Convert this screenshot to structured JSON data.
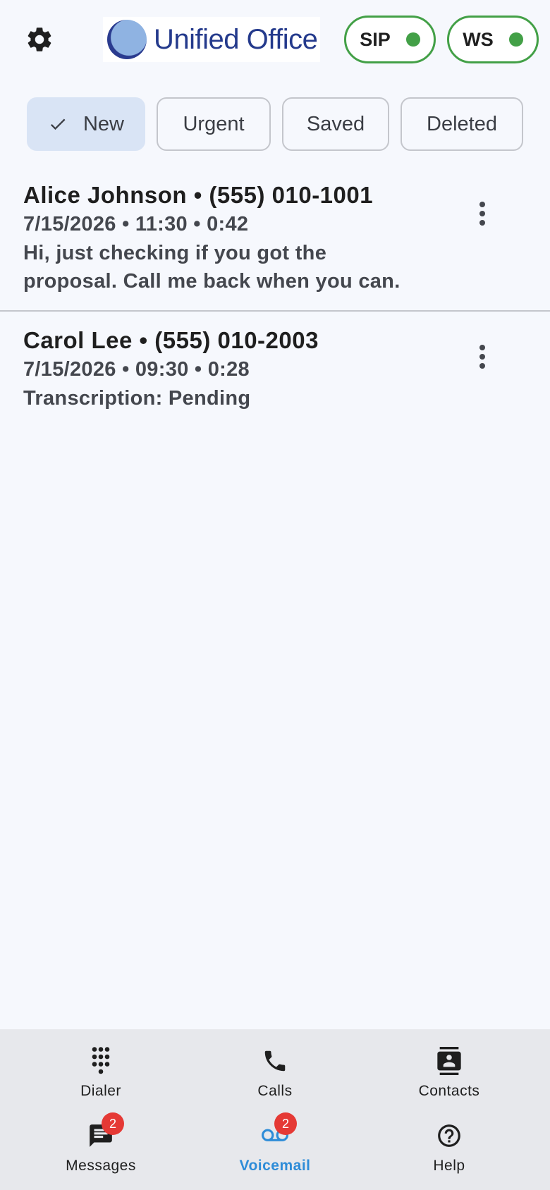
{
  "header": {
    "logo_text": "Unified Office",
    "status": [
      {
        "label": "SIP",
        "color": "#43a047"
      },
      {
        "label": "WS",
        "color": "#43a047"
      }
    ]
  },
  "filters": {
    "selected": "New",
    "chips": [
      "New",
      "Urgent",
      "Saved",
      "Deleted"
    ]
  },
  "voicemails": [
    {
      "title": "Alice Johnson • (555) 010-1001",
      "meta": "7/15/2026 • 11:30 • 0:42",
      "text": "Hi, just checking if you got the proposal. Call me back when you can."
    },
    {
      "title": "Carol Lee • (555) 010-2003",
      "meta": "7/15/2026 • 09:30 • 0:28",
      "text": "Transcription: Pending"
    }
  ],
  "nav": {
    "items": [
      {
        "label": "Dialer",
        "icon": "dialpad-icon"
      },
      {
        "label": "Calls",
        "icon": "phone-icon"
      },
      {
        "label": "Contacts",
        "icon": "contacts-icon"
      },
      {
        "label": "Messages",
        "icon": "message-icon",
        "badge": "2"
      },
      {
        "label": "Voicemail",
        "icon": "voicemail-icon",
        "badge": "2",
        "active": true
      },
      {
        "label": "Help",
        "icon": "help-icon"
      }
    ],
    "active_color": "#2e8cd8"
  }
}
